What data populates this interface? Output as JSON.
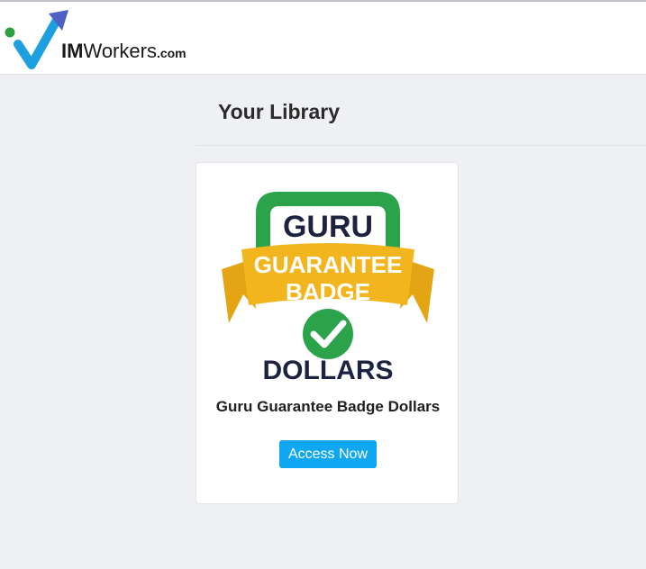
{
  "brand": {
    "name_prefix": "IM",
    "name_main": "Workers",
    "name_suffix": ".com",
    "colors": {
      "check": "#1e9fe0",
      "dot": "#2ea043",
      "arrow": "#4f5fc4"
    }
  },
  "page": {
    "title": "Your Library"
  },
  "library": {
    "items": [
      {
        "title": "Guru Guarantee Badge Dollars",
        "button_label": "Access Now",
        "image": {
          "top_word": "GURU",
          "ribbon_line1": "GUARANTEE",
          "ribbon_line2": "BADGE",
          "bottom_word": "DOLLARS",
          "colors": {
            "arch": "#2aa34a",
            "ribbon": "#f3b51d",
            "text": "#1b2340",
            "check": "#2aa34a"
          }
        }
      }
    ]
  },
  "colors": {
    "accent": "#10a7f2",
    "background": "#eef0f4"
  }
}
